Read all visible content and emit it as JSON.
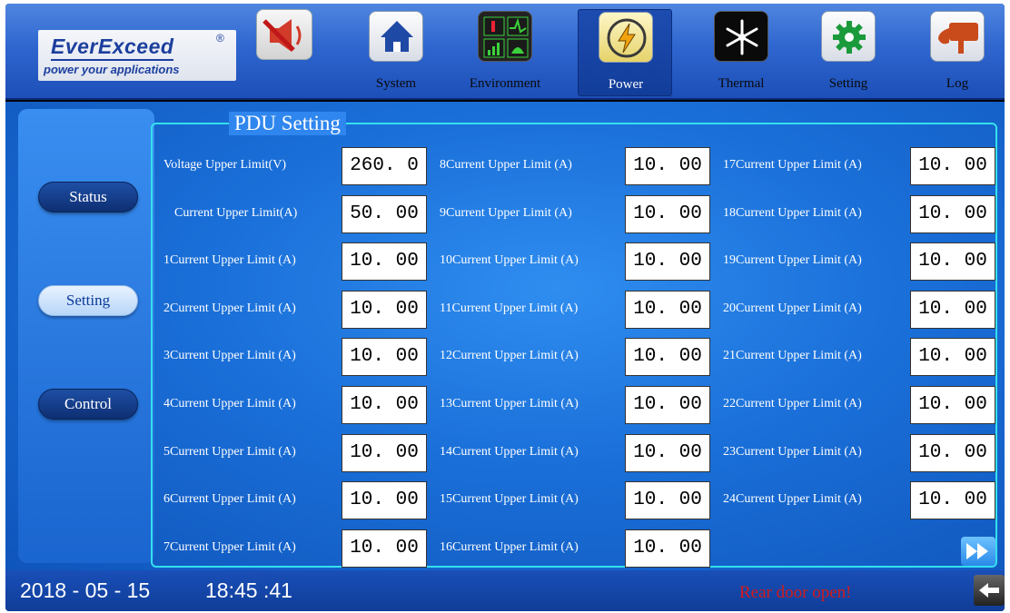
{
  "brand": {
    "name": "EverExceed",
    "registered": "®",
    "tagline": "power your applications"
  },
  "nav": [
    {
      "label": "System",
      "icon": "home-icon"
    },
    {
      "label": "Environment",
      "icon": "environment-monitor-icon"
    },
    {
      "label": "Power",
      "icon": "power-bolt-icon"
    },
    {
      "label": "Thermal",
      "icon": "snowflake-icon"
    },
    {
      "label": "Setting",
      "icon": "gear-icon"
    },
    {
      "label": "Log",
      "icon": "log-icon"
    }
  ],
  "sidebar": {
    "status_label": "Status",
    "setting_label": "Setting",
    "control_label": "Control"
  },
  "group_title": "PDU Setting",
  "fields": [
    {
      "label": "Voltage Upper Limit(V)",
      "value": "260. 0"
    },
    {
      "label": "Current Upper Limit(A)",
      "value": "50. 00"
    },
    {
      "label": "1Current Upper Limit (A)",
      "value": "10. 00"
    },
    {
      "label": "2Current Upper Limit (A)",
      "value": "10. 00"
    },
    {
      "label": "3Current Upper Limit (A)",
      "value": "10. 00"
    },
    {
      "label": "4Current Upper Limit (A)",
      "value": "10. 00"
    },
    {
      "label": "5Current Upper Limit (A)",
      "value": "10. 00"
    },
    {
      "label": "6Current Upper Limit (A)",
      "value": "10. 00"
    },
    {
      "label": "7Current Upper Limit (A)",
      "value": "10. 00"
    },
    {
      "label": "8Current Upper Limit (A)",
      "value": "10. 00"
    },
    {
      "label": "9Current Upper Limit (A)",
      "value": "10. 00"
    },
    {
      "label": "10Current Upper Limit (A)",
      "value": "10. 00"
    },
    {
      "label": "11Current Upper Limit (A)",
      "value": "10. 00"
    },
    {
      "label": "12Current Upper Limit (A)",
      "value": "10. 00"
    },
    {
      "label": "13Current Upper Limit (A)",
      "value": "10. 00"
    },
    {
      "label": "14Current Upper Limit (A)",
      "value": "10. 00"
    },
    {
      "label": "15Current Upper Limit (A)",
      "value": "10. 00"
    },
    {
      "label": "16Current Upper Limit (A)",
      "value": "10. 00"
    },
    {
      "label": "17Current Upper Limit (A)",
      "value": "10. 00"
    },
    {
      "label": "18Current Upper Limit (A)",
      "value": "10. 00"
    },
    {
      "label": "19Current Upper Limit (A)",
      "value": "10. 00"
    },
    {
      "label": "20Current Upper Limit (A)",
      "value": "10. 00"
    },
    {
      "label": "21Current Upper Limit (A)",
      "value": "10. 00"
    },
    {
      "label": "22Current Upper Limit (A)",
      "value": "10. 00"
    },
    {
      "label": "23Current Upper Limit (A)",
      "value": "10. 00"
    },
    {
      "label": "24Current Upper Limit (A)",
      "value": "10. 00"
    }
  ],
  "status_bar": {
    "date": "2018 - 05 - 15",
    "time": "18:45 :41",
    "alarm": "Rear door open!"
  },
  "colors": {
    "accent_border": "#34e0ee",
    "alarm": "#d31a1a",
    "header_blue": "#2f66cf"
  }
}
